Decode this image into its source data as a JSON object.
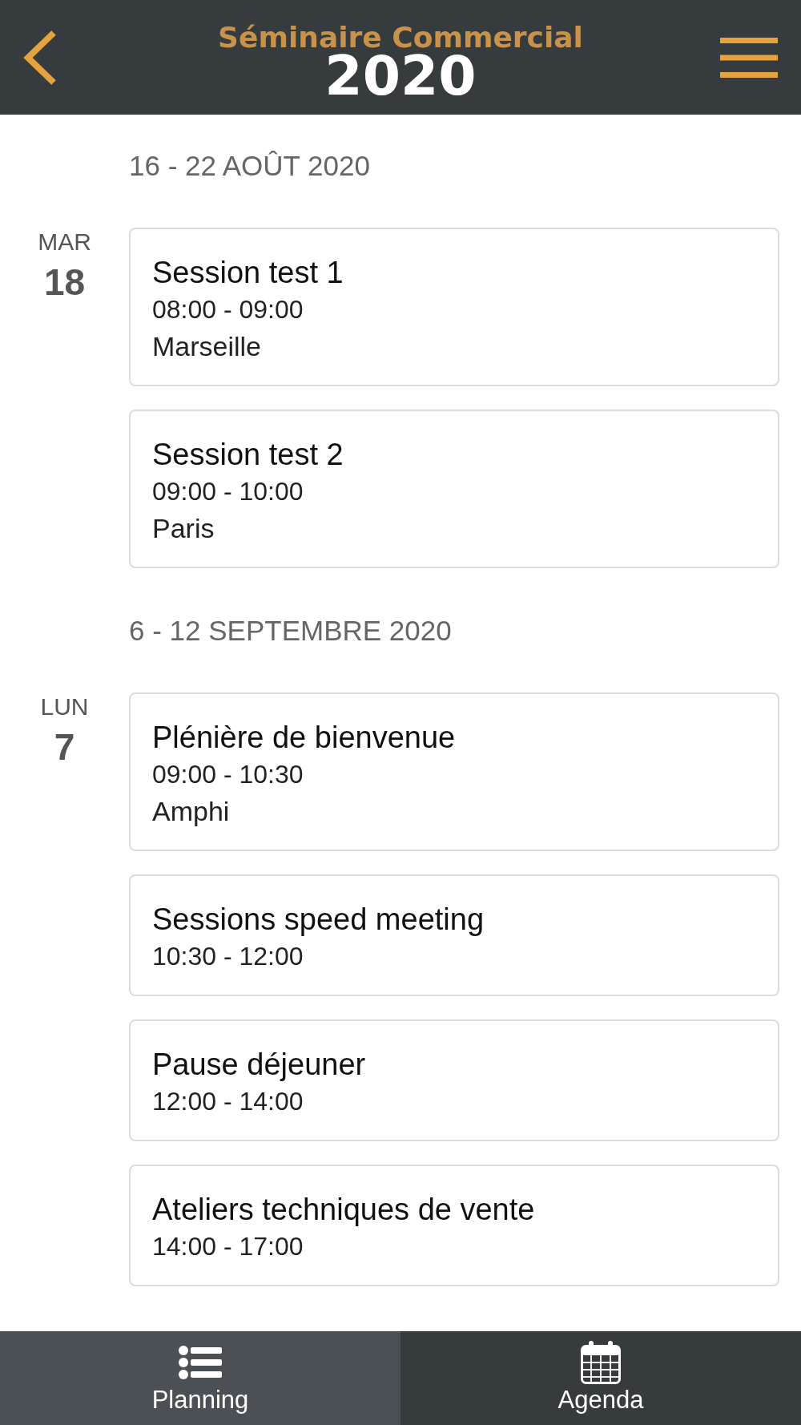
{
  "header": {
    "title": "Séminaire Commercial",
    "year": "2020"
  },
  "weeks": [
    {
      "label": "16 - 22 AOÛT 2020",
      "days": [
        {
          "weekday": "MAR",
          "day": "18",
          "sessions": [
            {
              "title": "Session test 1",
              "time": "08:00 - 09:00",
              "location": "Marseille"
            },
            {
              "title": "Session test 2",
              "time": "09:00 - 10:00",
              "location": "Paris"
            }
          ]
        }
      ]
    },
    {
      "label": "6 - 12 SEPTEMBRE 2020",
      "days": [
        {
          "weekday": "LUN",
          "day": "7",
          "sessions": [
            {
              "title": "Plénière de bienvenue",
              "time": "09:00 - 10:30",
              "location": "Amphi"
            },
            {
              "title": "Sessions speed meeting",
              "time": "10:30 - 12:00"
            },
            {
              "title": "Pause déjeuner",
              "time": "12:00 - 14:00"
            },
            {
              "title": "Ateliers techniques de vente",
              "time": "14:00 - 17:00"
            }
          ]
        }
      ]
    }
  ],
  "tab_bar": {
    "tabs": [
      {
        "label": "Planning",
        "selected": true
      },
      {
        "label": "Agenda",
        "selected": false
      }
    ]
  }
}
